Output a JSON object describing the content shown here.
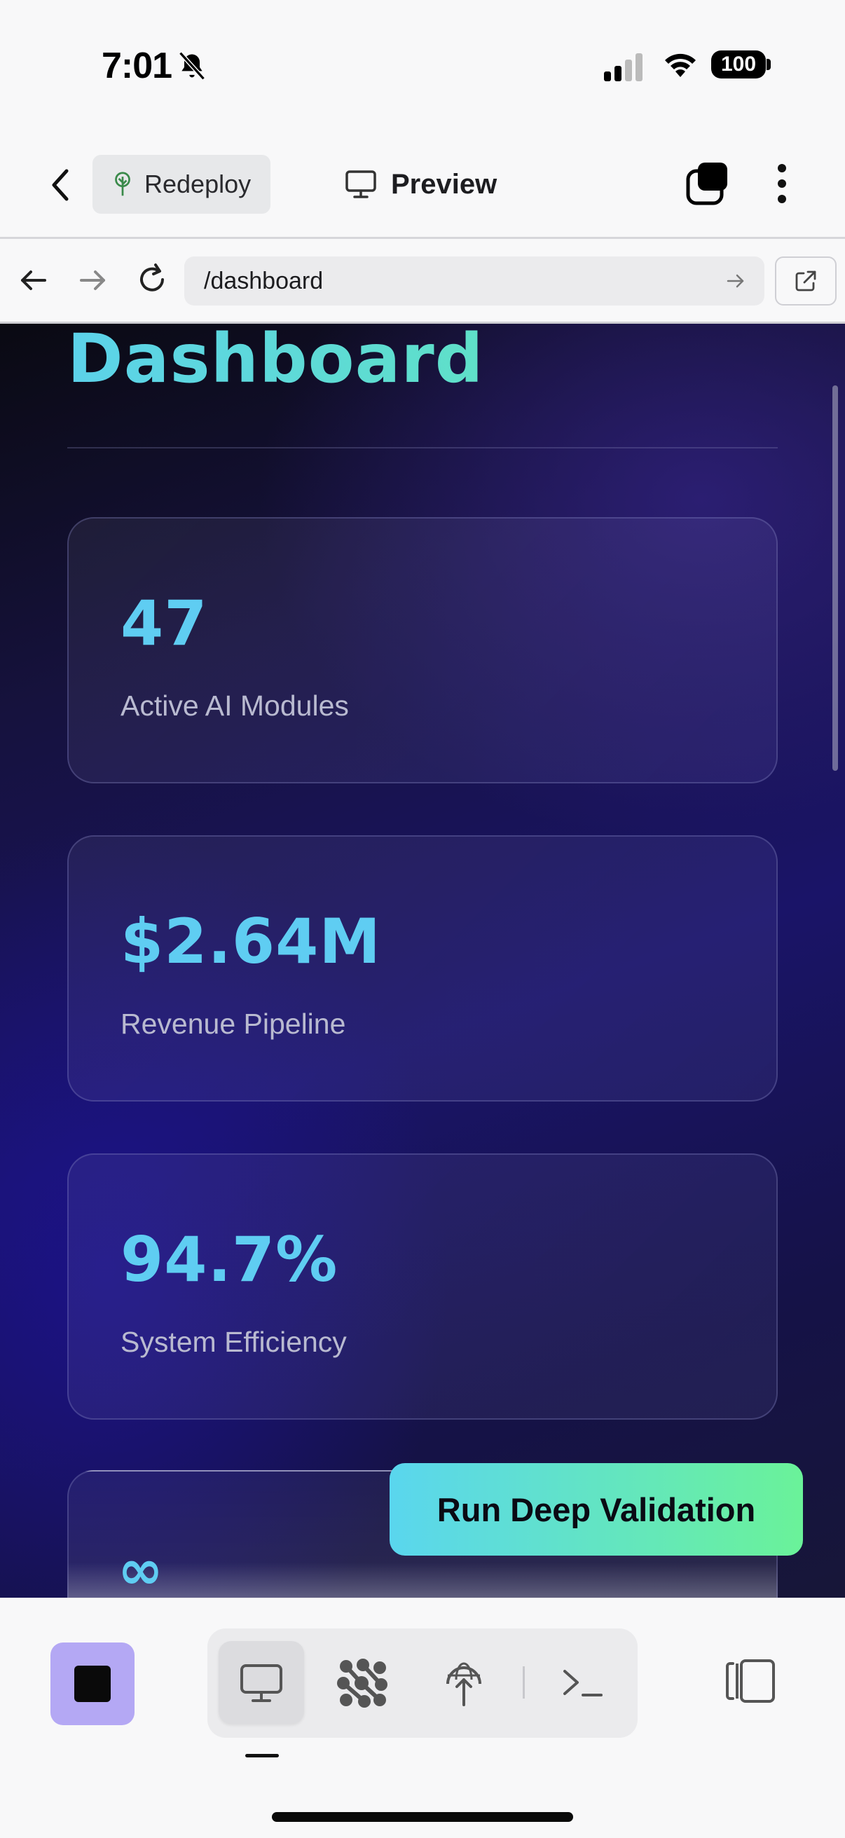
{
  "status_bar": {
    "time": "7:01",
    "battery": "100"
  },
  "app_bar": {
    "redeploy_label": "Redeploy",
    "preview_label": "Preview"
  },
  "url_bar": {
    "url": "/dashboard"
  },
  "page": {
    "title": "Dashboard",
    "stats": [
      {
        "value": "47",
        "label": "Active AI Modules"
      },
      {
        "value": "$2.64M",
        "label": "Revenue Pipeline"
      },
      {
        "value": "94.7%",
        "label": "System Efficiency"
      },
      {
        "value": "∞",
        "label": ""
      }
    ],
    "action_button": "Run Deep Validation"
  },
  "toolbar": {
    "icons": [
      "stop-icon",
      "monitor-icon",
      "network-icon",
      "deploy-icon",
      "terminal-icon",
      "panel-icon"
    ],
    "active_tab": "monitor"
  },
  "colors": {
    "accent_cyan": "#5fcdf2",
    "button_gradient_start": "#5ad6ee",
    "button_gradient_end": "#6af299",
    "stop_button": "#b4a8f4"
  }
}
